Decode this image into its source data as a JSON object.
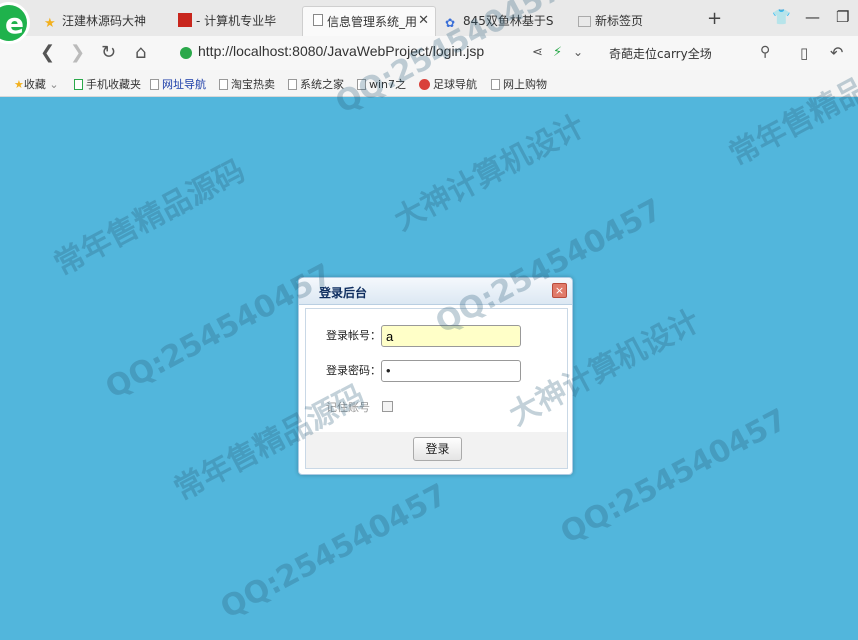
{
  "browser": {
    "tabs": [
      {
        "label": "汪建林源码大神",
        "icon": "star-icon",
        "active": false
      },
      {
        "label": "- 计算机专业毕",
        "icon": "site-icon",
        "active": false
      },
      {
        "label": "信息管理系统_用",
        "icon": "page-icon",
        "active": true
      },
      {
        "label": "845双鱼林基于S",
        "icon": "paw-icon",
        "active": false
      },
      {
        "label": "新标签页",
        "icon": "grid-icon",
        "active": false
      }
    ],
    "tab_close_glyph": "✕",
    "new_tab_glyph": "+",
    "url": "http://localhost:8080/JavaWebProject/login.jsp",
    "search_text": "奇葩走位carry全场",
    "bookmarks": [
      {
        "label": "收藏",
        "icon": "star-icon"
      },
      {
        "label": "手机收藏夹",
        "icon": "phone-icon"
      },
      {
        "label": "网址导航",
        "icon": "page-icon"
      },
      {
        "label": "淘宝热卖",
        "icon": "page-icon"
      },
      {
        "label": "系统之家",
        "icon": "page-icon"
      },
      {
        "label": "win7之",
        "icon": "page-icon"
      },
      {
        "label": "足球导航",
        "icon": "ball-icon"
      },
      {
        "label": "网上购物",
        "icon": "page-icon"
      }
    ]
  },
  "watermark": {
    "lines": [
      "QQ:254540457",
      "常年售精品源码",
      "大神计算机设计"
    ]
  },
  "login": {
    "title": "登录后台",
    "close_glyph": "×",
    "account_label": "登录帐号：",
    "account_value": "a",
    "password_label": "登录密码：",
    "password_value": "•",
    "remember_label": "记住账号",
    "submit_label": "登录"
  },
  "colors": {
    "background": "#52b6dc",
    "account_input_bg": "#ffffc8"
  }
}
